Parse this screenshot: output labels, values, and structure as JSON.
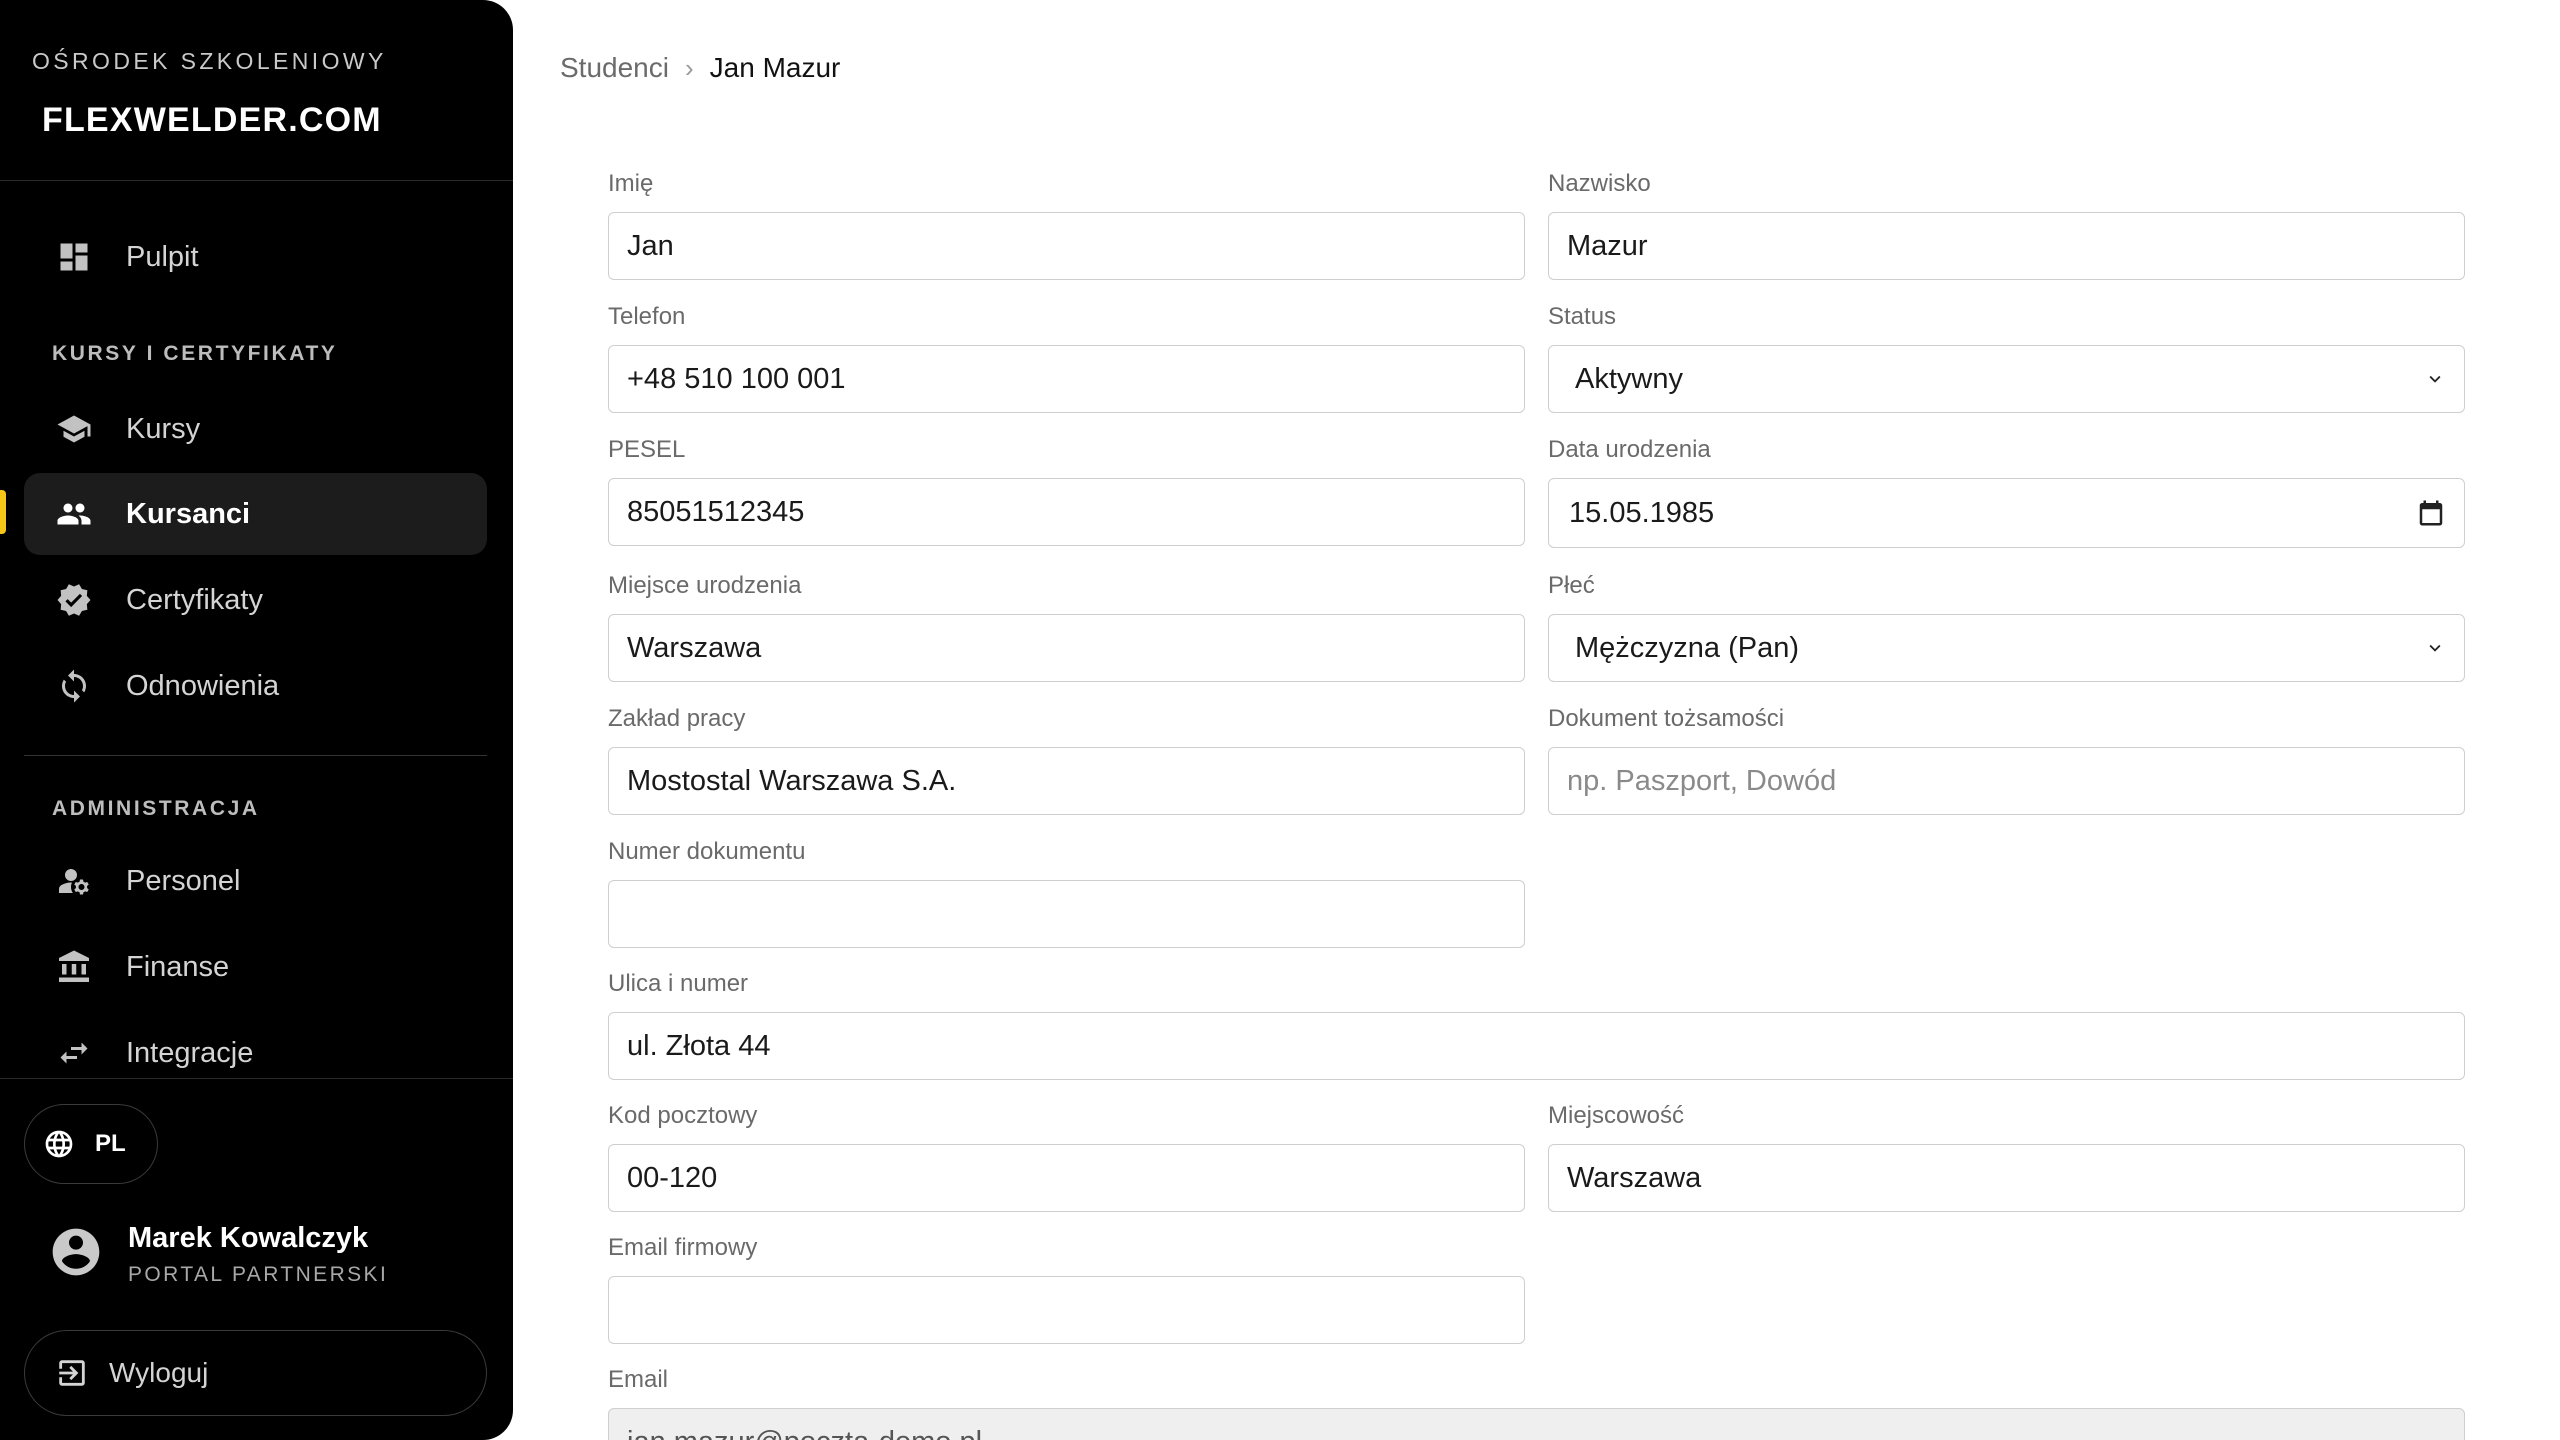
{
  "sidebar": {
    "brand_top": "OŚRODEK SZKOLENIOWY",
    "brand_logo": "FLEXWELDER.COM",
    "nav": {
      "dashboard": "Pulpit",
      "section_courses": "KURSY I CERTYFIKATY",
      "courses": "Kursy",
      "students": "Kursanci",
      "certificates": "Certyfikaty",
      "renewals": "Odnowienia",
      "section_admin": "ADMINISTRACJA",
      "staff": "Personel",
      "finance": "Finanse",
      "integrations": "Integracje"
    },
    "active_item": "Kursanci",
    "accent_color": "#f5c518",
    "language": "PL",
    "user": {
      "name": "Marek Kowalczyk",
      "role": "PORTAL PARTNERSKI"
    },
    "logout": "Wyloguj"
  },
  "breadcrumb": {
    "parent": "Studenci",
    "separator": "›",
    "current": "Jan Mazur"
  },
  "form": {
    "first_name": {
      "label": "Imię",
      "value": "Jan"
    },
    "last_name": {
      "label": "Nazwisko",
      "value": "Mazur"
    },
    "phone": {
      "label": "Telefon",
      "value": "+48 510 100 001"
    },
    "status": {
      "label": "Status",
      "value": "Aktywny"
    },
    "pesel": {
      "label": "PESEL",
      "value": "85051512345"
    },
    "birth_date": {
      "label": "Data urodzenia",
      "value": "15.05.1985"
    },
    "birth_place": {
      "label": "Miejsce urodzenia",
      "value": "Warszawa"
    },
    "gender": {
      "label": "Płeć",
      "value": "Mężczyzna (Pan)"
    },
    "employer": {
      "label": "Zakład pracy",
      "value": "Mostostal Warszawa S.A."
    },
    "id_document": {
      "label": "Dokument tożsamości",
      "value": "",
      "placeholder": "np. Paszport, Dowód"
    },
    "document_number": {
      "label": "Numer dokumentu",
      "value": ""
    },
    "street": {
      "label": "Ulica i numer",
      "value": "ul. Złota 44"
    },
    "postal_code": {
      "label": "Kod pocztowy",
      "value": "00-120"
    },
    "city": {
      "label": "Miejscowość",
      "value": "Warszawa"
    },
    "company_email": {
      "label": "Email firmowy",
      "value": ""
    },
    "email": {
      "label": "Email",
      "value": "jan.mazur@poczta-demo.pl"
    }
  }
}
